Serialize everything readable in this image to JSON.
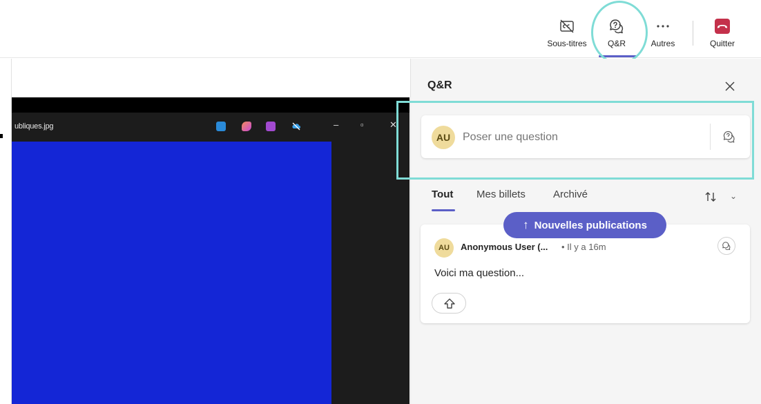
{
  "toolbar": {
    "captions_label": "Sous-titres",
    "qa_label": "Q&R",
    "more_label": "Autres",
    "leave_label": "Quitter",
    "leave_color": "#c4314b",
    "accent": "#5b5fc7"
  },
  "shared_screen": {
    "filename": "ubliques.jpg",
    "image_color": "#1426d6"
  },
  "qa_panel": {
    "title": "Q&R",
    "ask": {
      "avatar_initials": "AU",
      "placeholder": "Poser une question"
    },
    "tabs": [
      {
        "label": "Tout",
        "active": true
      },
      {
        "label": "Mes billets",
        "active": false
      },
      {
        "label": "Archivé",
        "active": false
      }
    ],
    "sort_icon": "sort-arrows-icon",
    "new_posts_label": "Nouvelles publications",
    "question": {
      "avatar_initials": "AU",
      "author": "Anonymous User (...",
      "time": "• Il y a 16m",
      "text": "Voici ma question..."
    }
  },
  "highlight_color": "#7fdcd6"
}
